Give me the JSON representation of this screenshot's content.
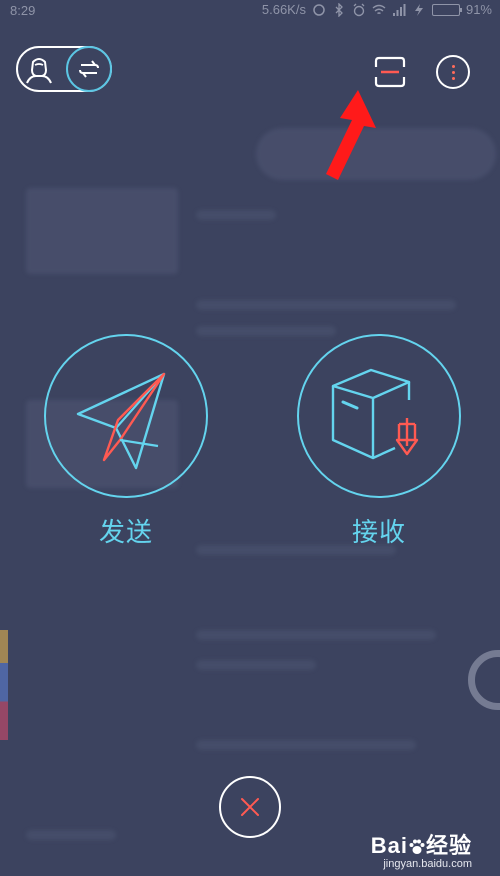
{
  "status_bar": {
    "time": "8:29",
    "network_speed": "5.66K/s",
    "battery_percent": "91%",
    "battery_level": 0.91
  },
  "top_bar": {
    "toggle_icons": [
      "user-icon",
      "swap-icon"
    ],
    "scan_icon": "scan-icon",
    "more_icon": "more-vertical-icon"
  },
  "actions": {
    "send": {
      "label": "发送",
      "icon": "paper-plane-icon"
    },
    "receive": {
      "label": "接收",
      "icon": "box-download-icon"
    }
  },
  "close_icon": "close-icon",
  "colors": {
    "background": "#3c435f",
    "accent_cyan": "#64d4ee",
    "accent_red": "#ff5a52",
    "annotation_arrow": "#ff1a1a"
  },
  "watermark": {
    "brand": "Bai",
    "brand_suffix": "经验",
    "url": "jingyan.baidu.com"
  }
}
